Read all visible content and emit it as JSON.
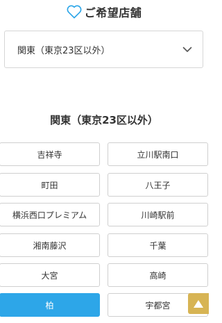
{
  "header": {
    "icon": "heart-icon",
    "title": "ご希望店舗"
  },
  "region_select": {
    "selected_value": "関東（東京23区以外）",
    "icon": "chevron-down-icon"
  },
  "section": {
    "title": "関東（東京23区以外）"
  },
  "stores": [
    {
      "label": "吉祥寺",
      "selected": false
    },
    {
      "label": "立川駅南口",
      "selected": false
    },
    {
      "label": "町田",
      "selected": false
    },
    {
      "label": "八王子",
      "selected": false
    },
    {
      "label": "横浜西口プレミアム",
      "selected": false
    },
    {
      "label": "川崎駅前",
      "selected": false
    },
    {
      "label": "湘南藤沢",
      "selected": false
    },
    {
      "label": "千葉",
      "selected": false
    },
    {
      "label": "大宮",
      "selected": false
    },
    {
      "label": "高崎",
      "selected": false
    },
    {
      "label": "柏",
      "selected": true
    },
    {
      "label": "宇都宮",
      "selected": false
    }
  ],
  "colors": {
    "accent": "#2da6e8",
    "heart": "#2da6e8",
    "scroll_top_button": "#d7b454"
  },
  "scroll_top": {
    "icon": "arrow-up-icon"
  }
}
